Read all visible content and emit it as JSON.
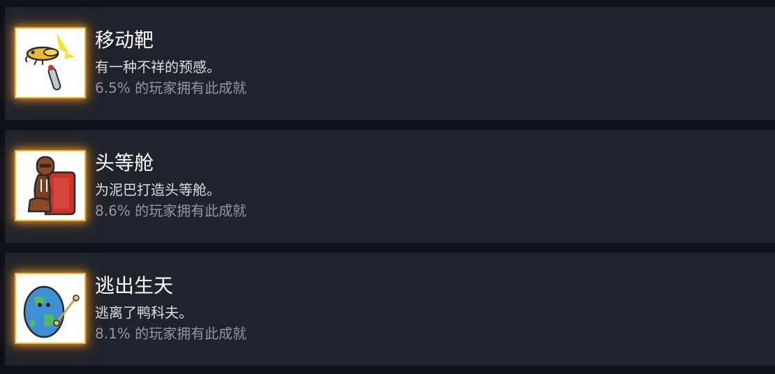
{
  "achievements": [
    {
      "title": "移动靶",
      "description": "有一种不祥的预感。",
      "unlock_rate": "6.5% 的玩家拥有此成就",
      "icon": "target-bird-icon"
    },
    {
      "title": "头等舱",
      "description": "为泥巴打造头等舱。",
      "unlock_rate": "8.6% 的玩家拥有此成就",
      "icon": "first-class-seat-icon"
    },
    {
      "title": "逃出生天",
      "description": "逃离了鸭科夫。",
      "unlock_rate": "8.1% 的玩家拥有此成就",
      "icon": "escape-globe-icon"
    }
  ],
  "colors": {
    "page_background": "#0d1119",
    "row_background": "#1f232d",
    "title": "#ffffff",
    "description": "#dcdedf",
    "unlock_rate": "#8f98a0",
    "icon_glow": "#ffaa28"
  }
}
